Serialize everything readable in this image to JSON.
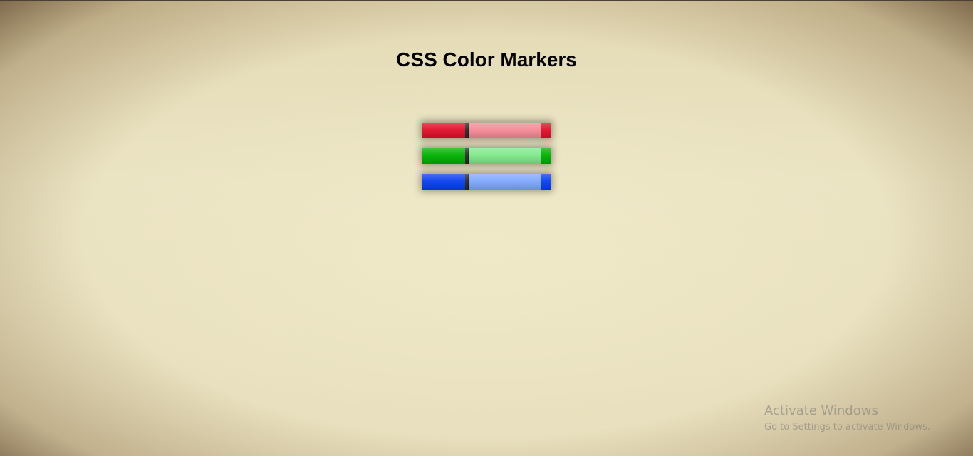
{
  "page": {
    "title": "CSS Color Markers"
  },
  "markers": [
    {
      "name": "red",
      "cap_color": "#e0102a",
      "body_color": "#f58a96",
      "tip_color": "#e0102a"
    },
    {
      "name": "green",
      "cap_color": "#00b000",
      "body_color": "#7fe88a",
      "tip_color": "#00b000"
    },
    {
      "name": "blue",
      "cap_color": "#0a3ff0",
      "body_color": "#7fa8ff",
      "tip_color": "#0a3ff0"
    }
  ],
  "watermark": {
    "title": "Activate Windows",
    "subtitle": "Go to Settings to activate Windows."
  }
}
